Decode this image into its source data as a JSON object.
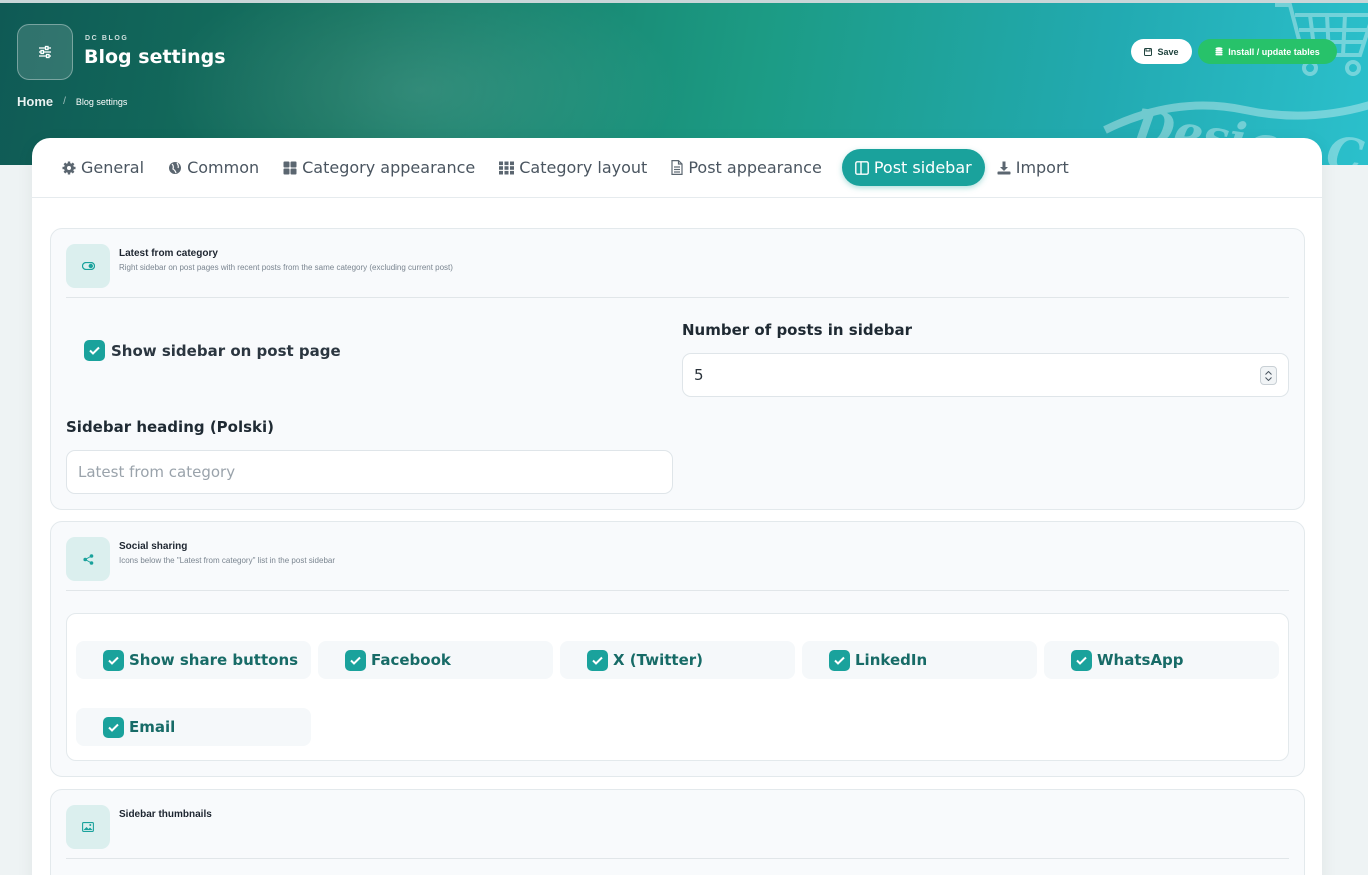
{
  "header": {
    "eyebrow": "DC BLOG",
    "title": "Blog settings",
    "breadcrumb": {
      "home": "Home",
      "current": "Blog settings"
    },
    "save_label": "Save",
    "install_label": "Install / update tables",
    "watermark_text": "Design C"
  },
  "tabs": [
    {
      "label": "General",
      "icon": "gear-icon"
    },
    {
      "label": "Common",
      "icon": "globe-icon"
    },
    {
      "label": "Category appearance",
      "icon": "grid-icon"
    },
    {
      "label": "Category layout",
      "icon": "grid-dots-icon"
    },
    {
      "label": "Post appearance",
      "icon": "file-icon"
    },
    {
      "label": "Post sidebar",
      "icon": "columns-icon",
      "active": true
    },
    {
      "label": "Import",
      "icon": "download-icon"
    }
  ],
  "latest": {
    "title": "Latest from category",
    "description": "Right sidebar on post pages with recent posts from the same category (excluding current post)",
    "show_sidebar_label": "Show sidebar on post page",
    "show_sidebar_checked": true,
    "num_posts_label": "Number of posts in sidebar",
    "num_posts_value": "5",
    "heading_label": "Sidebar heading (Polski)",
    "heading_placeholder": "Latest from category"
  },
  "social": {
    "title": "Social sharing",
    "description": "Icons below the \"Latest from category\" list in the post sidebar",
    "options": [
      {
        "label": "Show share buttons",
        "checked": true
      },
      {
        "label": "Facebook",
        "checked": true
      },
      {
        "label": "X (Twitter)",
        "checked": true
      },
      {
        "label": "LinkedIn",
        "checked": true
      },
      {
        "label": "WhatsApp",
        "checked": true
      },
      {
        "label": "Email",
        "checked": true
      }
    ]
  },
  "thumbnails": {
    "title": "Sidebar thumbnails"
  },
  "colors": {
    "accent": "#1aa29c",
    "install_green": "#27c26a",
    "chip_text": "#176b67"
  }
}
